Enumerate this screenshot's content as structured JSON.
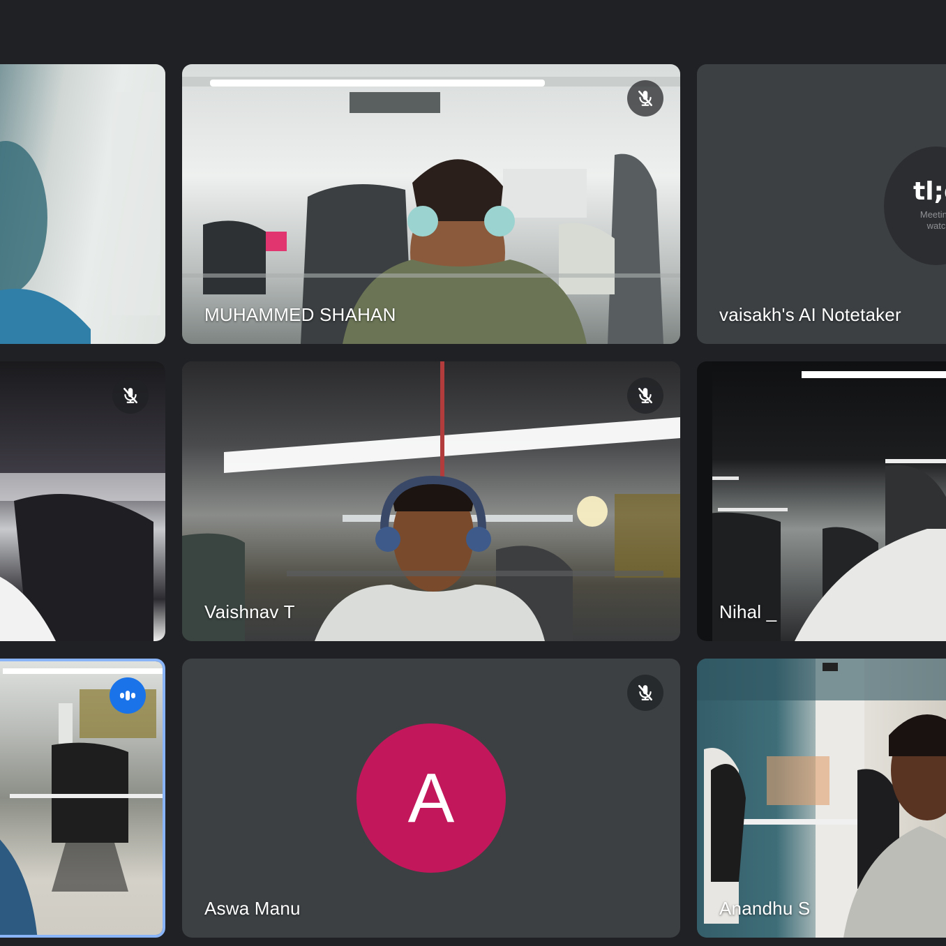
{
  "colors": {
    "background": "#202124",
    "tile_bg": "#3c4043",
    "active_speaker_border": "#8ab4f8",
    "speaking_badge": "#1a73e8",
    "avatar_a": "#c2185b"
  },
  "participants": [
    {
      "name": "",
      "muted": false,
      "speaking": false,
      "video": true
    },
    {
      "name": "MUHAMMED SHAHAN",
      "muted": true,
      "speaking": false,
      "video": true
    },
    {
      "name": "vaisakh's AI Notetaker",
      "muted": false,
      "speaking": false,
      "video": true,
      "logo_text": "tl;d",
      "tagline": "Meeting\nwatc"
    },
    {
      "name": "",
      "muted": true,
      "speaking": false,
      "video": true
    },
    {
      "name": "Vaishnav T",
      "muted": true,
      "speaking": false,
      "video": true
    },
    {
      "name": "Nihal _",
      "muted": false,
      "speaking": false,
      "video": true
    },
    {
      "name": "",
      "muted": false,
      "speaking": true,
      "video": true
    },
    {
      "name": "Aswa Manu",
      "muted": true,
      "speaking": false,
      "video": false,
      "avatar_letter": "A"
    },
    {
      "name": "Anandhu S",
      "muted": false,
      "speaking": false,
      "video": true
    }
  ],
  "icons": {
    "muted": "mic-off-icon",
    "speaking": "audio-level-icon"
  }
}
